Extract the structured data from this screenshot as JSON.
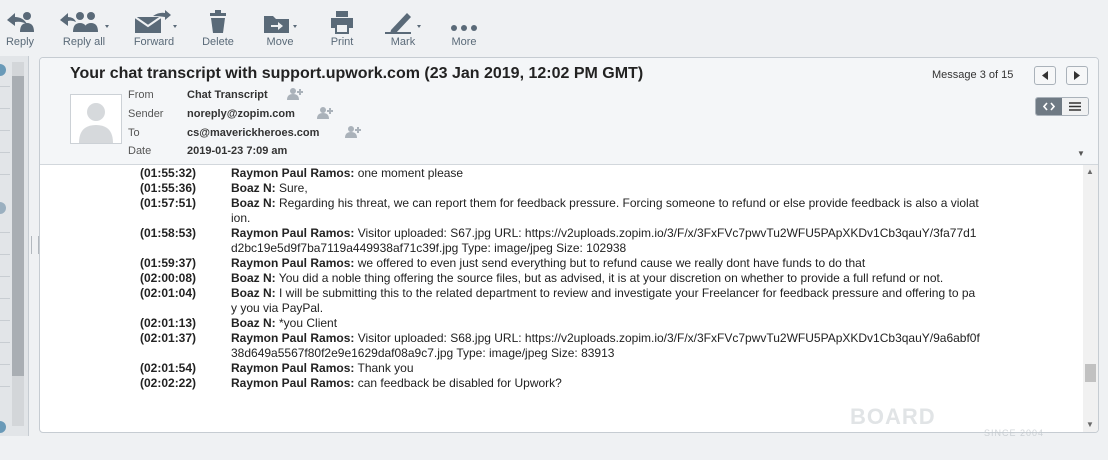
{
  "toolbar": {
    "reply": "Reply",
    "reply_all": "Reply all",
    "forward": "Forward",
    "delete": "Delete",
    "move": "Move",
    "print": "Print",
    "mark": "Mark",
    "more": "More"
  },
  "message": {
    "subject": "Your chat transcript with support.upwork.com (23 Jan 2019, 12:02 PM GMT)",
    "counter": "Message 3 of 15",
    "fields": {
      "from_label": "From",
      "from_value": "Chat Transcript",
      "sender_label": "Sender",
      "sender_value": "noreply@zopim.com",
      "to_label": "To",
      "to_value": "cs@maverickheroes.com",
      "date_label": "Date",
      "date_value": "2019-01-23 7:09 am"
    }
  },
  "transcript": [
    {
      "time": "(01:55:32)",
      "name": "Raymon Paul Ramos:",
      "text": " one moment please"
    },
    {
      "time": "(01:55:36)",
      "name": "Boaz N:",
      "text": " Sure,"
    },
    {
      "time": "(01:57:51)",
      "name": "Boaz N:",
      "text": " Regarding his threat, we can report them for feedback pressure. Forcing someone to refund or else provide feedback is also a violation."
    },
    {
      "time": "(01:58:53)",
      "name": "Raymon Paul Ramos:",
      "text": " Visitor uploaded: S67.jpg URL: https://v2uploads.zopim.io/3/F/x/3FxFVc7pwvTu2WFU5PApXKDv1Cb3qauY/3fa77d1d2bc19e5d9f7ba7119a449938af71c39f.jpg Type: image/jpeg Size: 102938"
    },
    {
      "time": "(01:59:37)",
      "name": "Raymon Paul Ramos:",
      "text": " we offered to even just send everything but to refund cause we really dont have funds to do that"
    },
    {
      "time": "(02:00:08)",
      "name": "Boaz N:",
      "text": " You did a noble thing offering the source files, but as advised, it is at your discretion on whether to provide a full refund or not."
    },
    {
      "time": "(02:01:04)",
      "name": "Boaz N:",
      "text": " I will be submitting this to the related department to review and investigate your Freelancer for feedback pressure and offering to pay you via PayPal."
    },
    {
      "time": "(02:01:13)",
      "name": "Boaz N:",
      "text": " *you Client"
    },
    {
      "time": "(02:01:37)",
      "name": "Raymon Paul Ramos:",
      "text": " Visitor uploaded: S68.jpg URL: https://v2uploads.zopim.io/3/F/x/3FxFVc7pwvTu2WFU5PApXKDv1Cb3qauY/9a6abf0f38d649a5567f80f2e9e1629daf08a9c7.jpg Type: image/jpeg Size: 83913"
    },
    {
      "time": "(02:01:54)",
      "name": "Raymon Paul Ramos:",
      "text": " Thank you"
    },
    {
      "time": "(02:02:22)",
      "name": "Raymon Paul Ramos:",
      "text": " can feedback be disabled for Upwork?"
    }
  ],
  "watermark": {
    "main": "BOARD",
    "sub": "SINCE 2004"
  },
  "colors": {
    "icon": "#5a6a78",
    "panel_bg": "#ffffff",
    "header_bg": "#f4f6f8"
  }
}
